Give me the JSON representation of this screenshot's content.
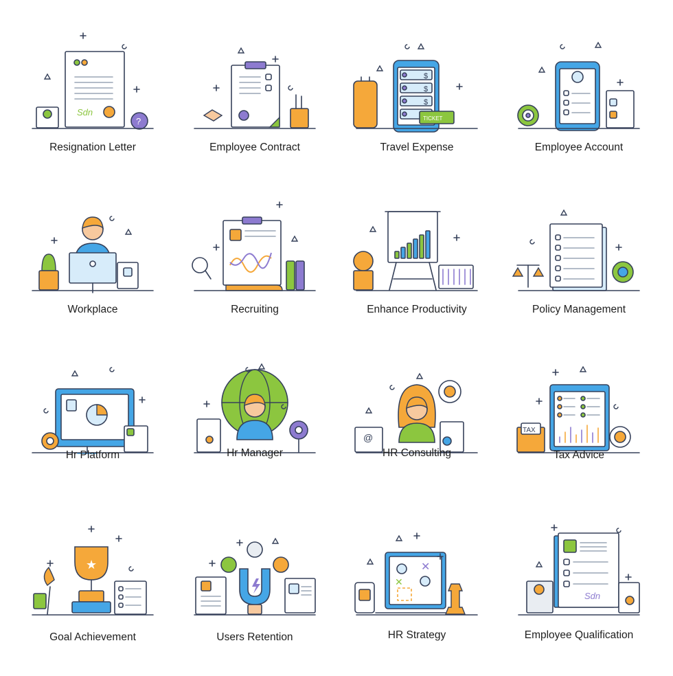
{
  "colors": {
    "outline": "#36415a",
    "blue": "#45a6e6",
    "lightblue": "#d7ecfa",
    "orange": "#f5a83a",
    "green": "#8cc63f",
    "purple": "#8d7bd0",
    "skin": "#f7c99e",
    "paper": "#ffffff",
    "gray": "#e9edf2"
  },
  "icons": [
    {
      "label": "Resignation Letter",
      "icon": "resignation-letter-icon",
      "kind": "letter"
    },
    {
      "label": "Employee Contract",
      "icon": "employee-contract-icon",
      "kind": "clipboard"
    },
    {
      "label": "Travel Expense",
      "icon": "travel-expense-icon",
      "kind": "phone-list"
    },
    {
      "label": "Employee Account",
      "icon": "employee-account-icon",
      "kind": "phone-profile"
    },
    {
      "label": "Workplace",
      "icon": "workplace-icon",
      "kind": "workplace"
    },
    {
      "label": "Recruiting",
      "icon": "recruiting-icon",
      "kind": "clipboard-chart"
    },
    {
      "label": "Enhance Productivity",
      "icon": "enhance-productivity-icon",
      "kind": "easel"
    },
    {
      "label": "Policy Management",
      "icon": "policy-management-icon",
      "kind": "notebook"
    },
    {
      "label": "Hr Platform",
      "icon": "hr-platform-icon",
      "kind": "monitor"
    },
    {
      "label": "Hr Manager",
      "icon": "hr-manager-icon",
      "kind": "globe-person"
    },
    {
      "label": "HR Consulting",
      "icon": "hr-consulting-icon",
      "kind": "woman"
    },
    {
      "label": "Tax Advice",
      "icon": "tax-advice-icon",
      "kind": "browser-chart"
    },
    {
      "label": "Goal Achievement",
      "icon": "goal-achievement-icon",
      "kind": "trophy"
    },
    {
      "label": "Users Retention",
      "icon": "users-retention-icon",
      "kind": "magnet"
    },
    {
      "label": "HR Strategy",
      "icon": "hr-strategy-icon",
      "kind": "laptop-strategy"
    },
    {
      "label": "Employee Qualification",
      "icon": "employee-qualification-icon",
      "kind": "certificate"
    }
  ]
}
